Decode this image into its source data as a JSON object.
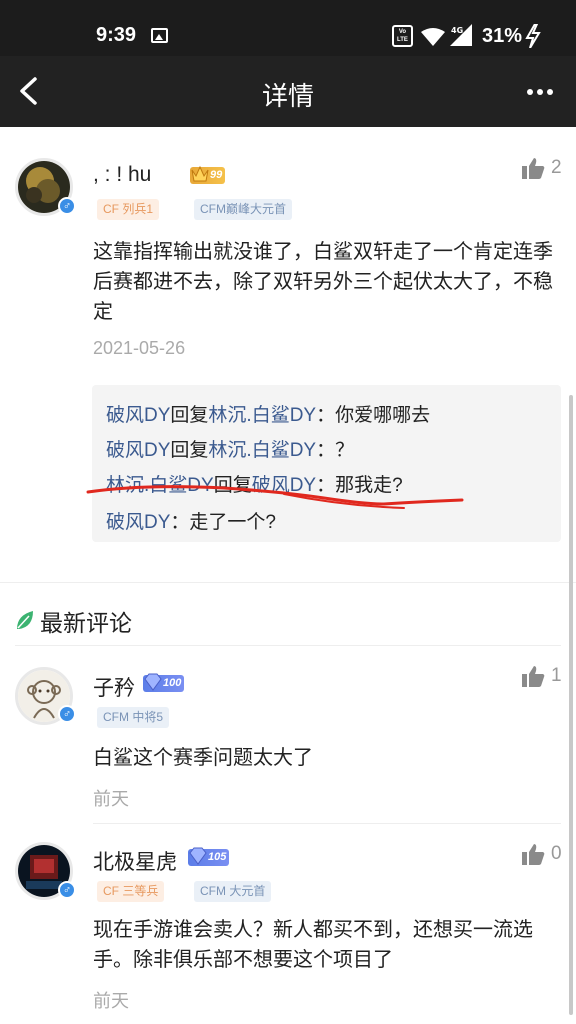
{
  "status_bar": {
    "time": "9:39",
    "battery": "31%",
    "volte_label": "Vo LTE",
    "network_label": "4G"
  },
  "header": {
    "title": "详情"
  },
  "main_comment": {
    "username": ", : ! hu",
    "badge_level": "99",
    "tags": [
      "CF 列兵1",
      "CFM巅峰大元首"
    ],
    "likes": "2",
    "text": "这靠指挥输出就没谁了，白鲨双轩走了一个肯定连季后赛都进不去，除了双轩另外三个起伏太大了，不稳定",
    "date": "2021-05-26",
    "replies": [
      {
        "from": "破风DY",
        "verb": "回复",
        "to": "林沉.白鲨DY",
        "sep": "：",
        "text": "你爱哪哪去"
      },
      {
        "from": "破风DY",
        "verb": "回复",
        "to": "林沉.白鲨DY",
        "sep": "：",
        "text": "？"
      },
      {
        "from": "林沉.白鲨DY",
        "verb": "回复",
        "to": "破风DY",
        "sep": "：",
        "text": "那我走?"
      },
      {
        "from": "破风DY",
        "verb": "",
        "to": "",
        "sep": "：",
        "text": "走了一个?"
      }
    ]
  },
  "latest_section": {
    "title": "最新评论"
  },
  "comments": [
    {
      "username": "子矜",
      "badge_level": "100",
      "tags": [
        "CFM 中将5"
      ],
      "likes": "1",
      "text": "白鲨这个赛季问题太大了",
      "date": "前天"
    },
    {
      "username": "北极星虎",
      "badge_level": "105",
      "tags": [
        "CF 三等兵",
        "CFM 大元首"
      ],
      "likes": "0",
      "text": "现在手游谁会卖人？新人都买不到，还想买一流选手。除非俱乐部不想要这个项目了",
      "date": "前天"
    }
  ],
  "colors": {
    "status_bar": "#1c1c1c",
    "app_bar": "#222222",
    "reply_name": "#3b5a8f",
    "annotation_red": "#e0281e",
    "leaf_green": "#3cb371"
  }
}
